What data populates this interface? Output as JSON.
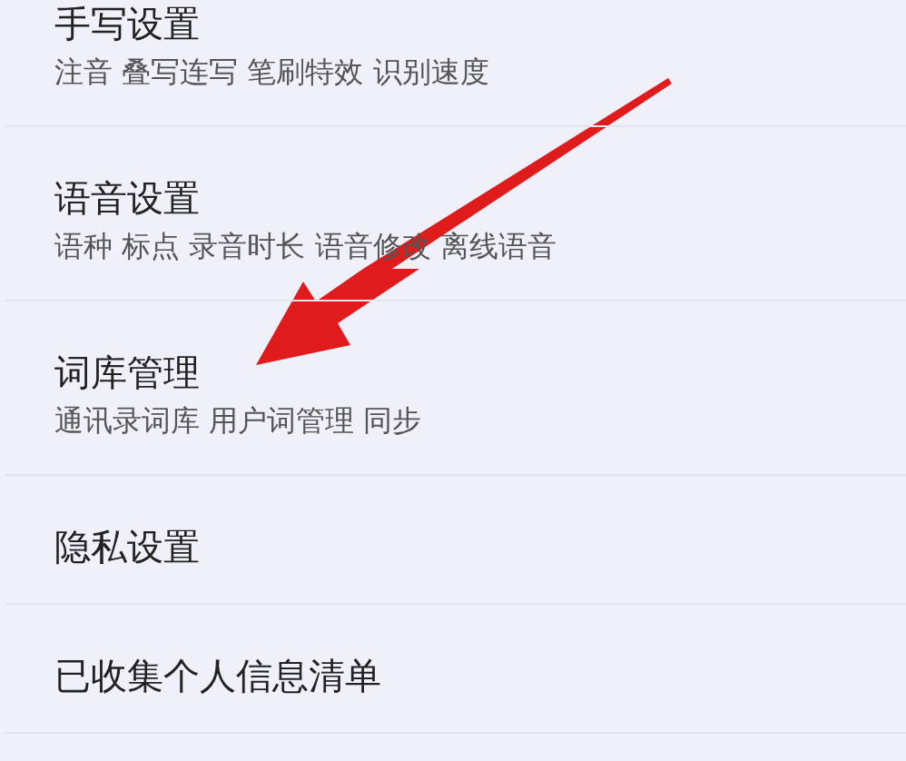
{
  "settings": [
    {
      "title": "手写设置",
      "subtitle": "注音 叠写连写 笔刷特效 识别速度"
    },
    {
      "title": "语音设置",
      "subtitle": "语种 标点 录音时长 语音修改 离线语音"
    },
    {
      "title": "词库管理",
      "subtitle": "通讯录词库 用户词管理 同步"
    },
    {
      "title": "隐私设置"
    },
    {
      "title": "已收集个人信息清单"
    }
  ]
}
